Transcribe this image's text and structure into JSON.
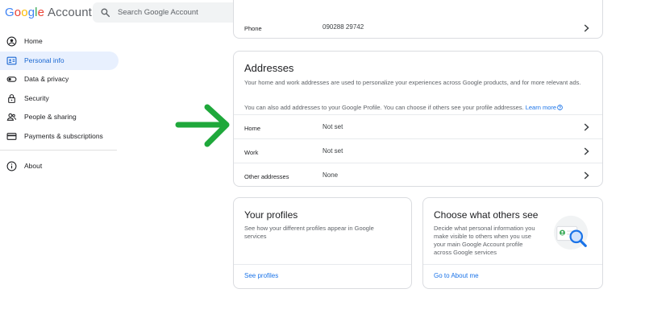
{
  "header": {
    "logo_parts": [
      "G",
      "o",
      "o",
      "g",
      "l",
      "e"
    ],
    "logo_account": "Account",
    "search_placeholder": "Search Google Account"
  },
  "sidebar": {
    "items": [
      {
        "label": "Home",
        "icon": "person-circle-icon",
        "active": false
      },
      {
        "label": "Personal info",
        "icon": "id-card-icon",
        "active": true
      },
      {
        "label": "Data & privacy",
        "icon": "toggle-icon",
        "active": false
      },
      {
        "label": "Security",
        "icon": "lock-icon",
        "active": false
      },
      {
        "label": "People & sharing",
        "icon": "people-icon",
        "active": false
      },
      {
        "label": "Payments & subscriptions",
        "icon": "credit-card-icon",
        "active": false
      }
    ],
    "about": {
      "label": "About",
      "icon": "info-icon"
    }
  },
  "phone_row": {
    "label": "Phone",
    "value": "090288 29742"
  },
  "addresses": {
    "title": "Addresses",
    "description": "Your home and work addresses are used to personalize your experiences across Google products, and for more relevant ads.",
    "note": "You can also add addresses to your Google Profile. You can choose if others see your profile addresses.",
    "learn_more": "Learn more",
    "rows": [
      {
        "label": "Home",
        "value": "Not set"
      },
      {
        "label": "Work",
        "value": "Not set"
      },
      {
        "label": "Other addresses",
        "value": "None"
      }
    ]
  },
  "profiles_card": {
    "title": "Your profiles",
    "description_lines": [
      "See how your different profiles appear in Google",
      "services"
    ],
    "link": "See profiles"
  },
  "others_card": {
    "title": "Choose what others see",
    "description_lines": [
      "Decide what personal information you",
      "make visible to others when you use",
      "your main Google Account profile",
      "across Google services"
    ],
    "link": "Go to About me"
  },
  "colors": {
    "accent_blue": "#1a73e8",
    "active_bg": "#e8f0fe",
    "arrow_green": "#1fa83b"
  }
}
